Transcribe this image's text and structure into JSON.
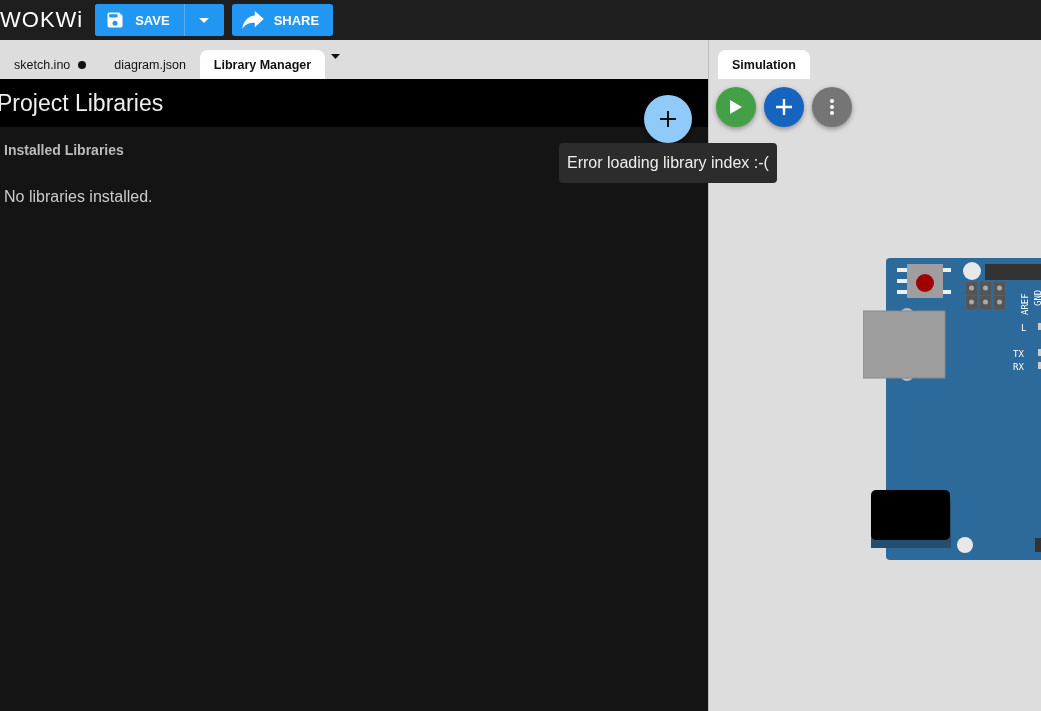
{
  "header": {
    "logo": "WOKWi",
    "save_button": "SAVE",
    "share_button": "SHARE"
  },
  "editor_tabs": [
    {
      "label": "sketch.ino",
      "modified": true,
      "selected": false
    },
    {
      "label": "diagram.json",
      "modified": false,
      "selected": false
    },
    {
      "label": "Library Manager",
      "modified": false,
      "selected": true
    }
  ],
  "library_manager": {
    "title": "Project Libraries",
    "section": "Installed Libraries",
    "empty_message": "No libraries installed.",
    "tooltip": "Error loading library index :-("
  },
  "simulation": {
    "tabs": [
      {
        "label": "Simulation",
        "selected": true
      }
    ],
    "board_labels": [
      "AREF",
      "GND",
      "L",
      "TX",
      "RX"
    ]
  }
}
